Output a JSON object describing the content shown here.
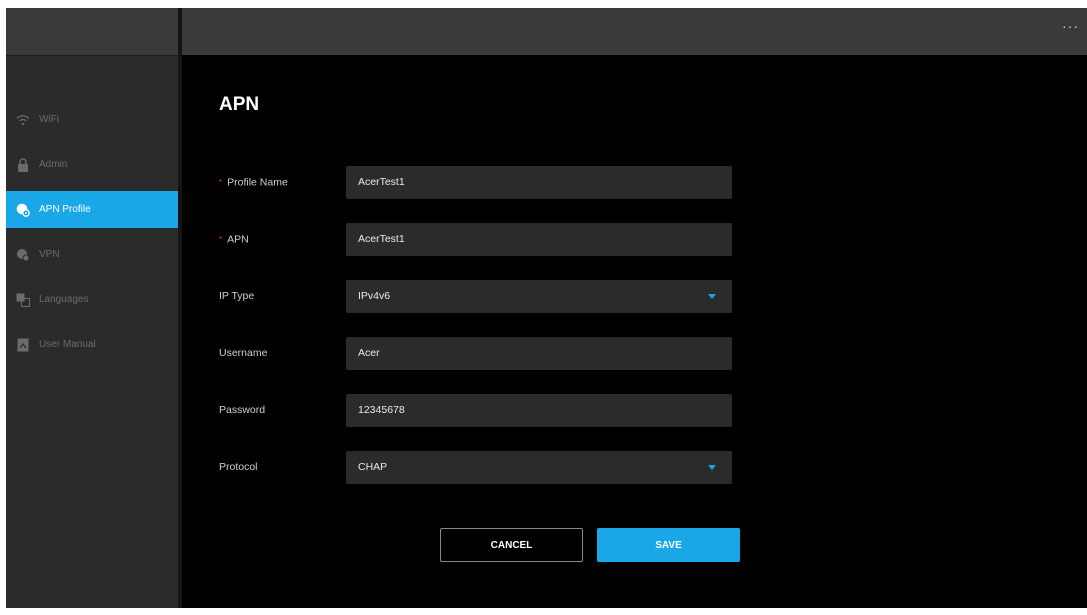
{
  "topbar": {
    "more_label": "···"
  },
  "sidebar": {
    "items": [
      {
        "label": "WiFi",
        "icon": "wifi-icon",
        "active": false
      },
      {
        "label": "Admin",
        "icon": "lock-icon",
        "active": false
      },
      {
        "label": "APN Profile",
        "icon": "globe-gear-icon",
        "active": true
      },
      {
        "label": "VPN",
        "icon": "vpn-icon",
        "active": false
      },
      {
        "label": "Languages",
        "icon": "languages-icon",
        "active": false
      },
      {
        "label": "User Manual",
        "icon": "manual-icon",
        "active": false
      }
    ]
  },
  "main": {
    "title": "APN",
    "form": {
      "profile_name": {
        "label": "Profile Name",
        "required_mark": "*",
        "value": "AcerTest1"
      },
      "apn": {
        "label": "APN",
        "required_mark": "*",
        "value": "AcerTest1"
      },
      "ip_type": {
        "label": "IP Type",
        "value": "IPv4v6"
      },
      "username": {
        "label": "Username",
        "value": "Acer"
      },
      "password": {
        "label": "Password",
        "value": "12345678"
      },
      "protocol": {
        "label": "Protocol",
        "value": "CHAP"
      }
    },
    "cancel_label": "CANCEL",
    "save_label": "SAVE"
  },
  "colors": {
    "accent": "#19a7e8",
    "required": "#e53935",
    "field_bg": "#2b2b2b",
    "sidebar_bg": "#2b2b2b",
    "topbar_bg": "#3a3a3a"
  }
}
